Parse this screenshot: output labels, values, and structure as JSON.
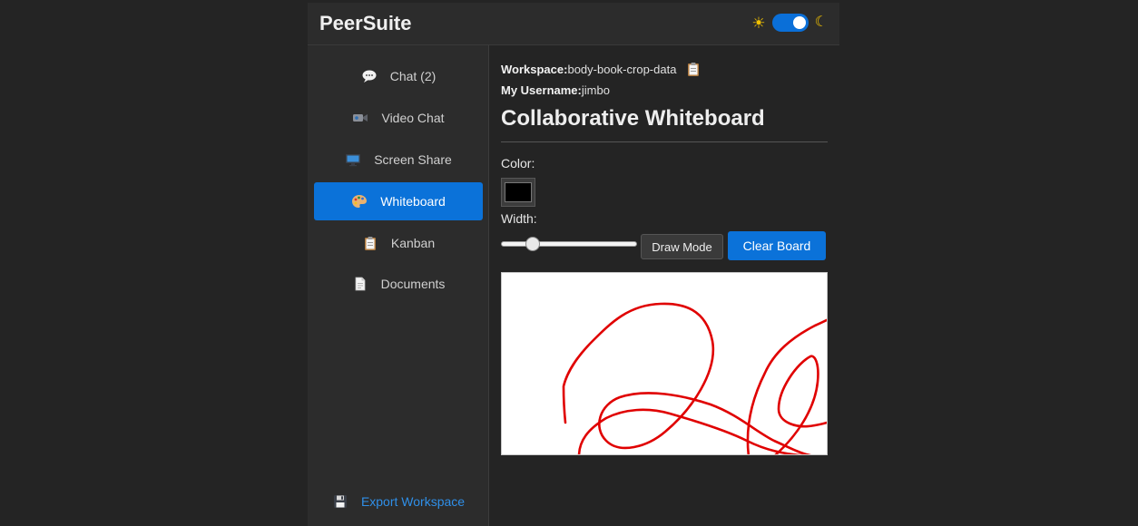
{
  "app": {
    "brand": "PeerSuite",
    "theme": {
      "light_icon": "sun-icon",
      "dark_icon": "moon-icon",
      "dark_mode_on": true
    }
  },
  "sidebar": {
    "items": [
      {
        "label": "Chat (2)",
        "icon": "speech-bubble-icon",
        "active": false
      },
      {
        "label": "Video Chat",
        "icon": "video-camera-icon",
        "active": false
      },
      {
        "label": "Screen Share",
        "icon": "monitor-icon",
        "active": false
      },
      {
        "label": "Whiteboard",
        "icon": "palette-icon",
        "active": true
      },
      {
        "label": "Kanban",
        "icon": "clipboard-icon",
        "active": false
      },
      {
        "label": "Documents",
        "icon": "document-icon",
        "active": false
      }
    ],
    "export": {
      "label": "Export Workspace",
      "icon": "floppy-disk-icon"
    }
  },
  "main": {
    "workspace_label": "Workspace:",
    "workspace_value": "body-book-crop-data",
    "username_label": "My Username:",
    "username_value": "jimbo",
    "title": "Collaborative Whiteboard",
    "color_label": "Color:",
    "color_value": "#000000",
    "width_label": "Width:",
    "width_fraction": 0.2,
    "draw_mode_label": "Draw Mode",
    "clear_label": "Clear Board",
    "stroke_color": "#e00000"
  },
  "colors": {
    "accent": "#0b72d9",
    "background": "#242424",
    "panel": "#2c2c2c",
    "link": "#2f8fe8"
  }
}
